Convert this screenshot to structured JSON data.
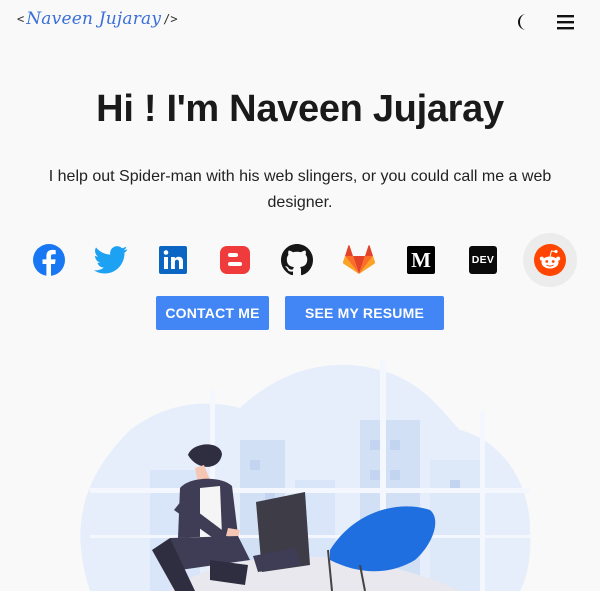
{
  "nav": {
    "logo_open": "<",
    "logo_name": "Naveen Jujaray",
    "logo_close": "/>",
    "theme_icon": "moon-icon",
    "menu_icon": "hamburger-menu-icon"
  },
  "hero": {
    "title": "Hi ! I'm Naveen Jujaray",
    "subtitle": "I help out Spider-man with his web slingers, or you could call me a web designer."
  },
  "socials": [
    {
      "name": "facebook-icon",
      "color": "#1877f2"
    },
    {
      "name": "twitter-icon",
      "color": "#1da1f2"
    },
    {
      "name": "linkedin-icon",
      "color": "#0a66c2"
    },
    {
      "name": "blogger-icon",
      "color": "#ef3b3b"
    },
    {
      "name": "github-icon",
      "color": "#181717"
    },
    {
      "name": "gitlab-icon",
      "color": "#fc6d26"
    },
    {
      "name": "medium-icon",
      "color": "#000000"
    },
    {
      "name": "dev-icon",
      "color": "#0a0a0a"
    },
    {
      "name": "reddit-icon",
      "color": "#ff4500"
    }
  ],
  "dev_label": "DEV",
  "medium_label": "M",
  "in_label": "in",
  "buttons": {
    "contact": "CONTACT ME",
    "resume": "SEE MY RESUME"
  },
  "colors": {
    "accent": "#4285f4",
    "background": "#f9f9f9"
  }
}
